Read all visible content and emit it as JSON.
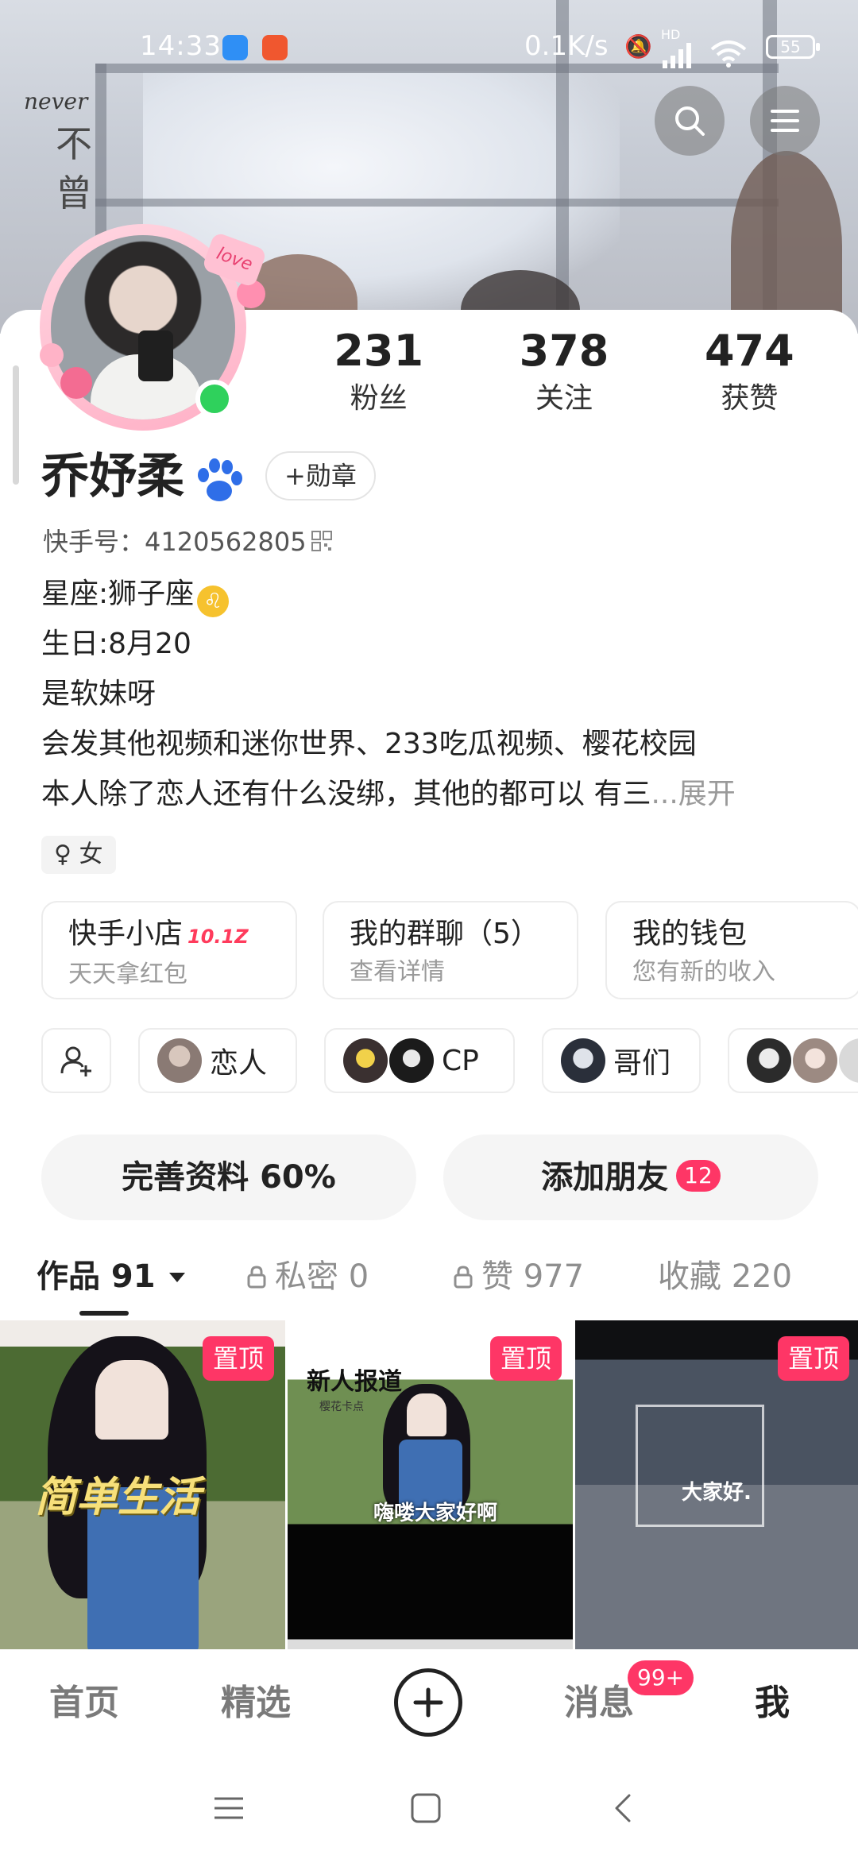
{
  "status_bar": {
    "time": "14:33",
    "net_speed": "0.1K/s",
    "network_label": "HD",
    "battery": "55"
  },
  "header": {
    "banner_vertical_text_latin": "never",
    "banner_vertical_text_cn": "不曾",
    "search_icon": "search-icon",
    "menu_icon": "menu-icon"
  },
  "profile": {
    "avatar_sticker": "love",
    "stats": [
      {
        "value": "231",
        "label": "粉丝"
      },
      {
        "value": "378",
        "label": "关注"
      },
      {
        "value": "474",
        "label": "获赞"
      }
    ],
    "name": "乔妤柔",
    "medal_button": "+勋章",
    "kwai_id": "快手号：4120562805",
    "bio": {
      "line1": "星座:狮子座",
      "leo_symbol": "♌",
      "line2": "生日:8月20",
      "line3": "是软妹呀",
      "line4": "会发其他视频和迷你世界、233吃瓜视频、樱花校园",
      "line5": "本人除了恋人还有什么没绑，其他的都可以 有三",
      "expand": "...展开"
    },
    "gender_tag": "♀ 女"
  },
  "features": [
    {
      "title": "快手小店",
      "hot": "10.1Z",
      "subtitle": "天天拿红包"
    },
    {
      "title": "我的群聊（5）",
      "subtitle": "查看详情"
    },
    {
      "title": "我的钱包",
      "subtitle": "您有新的收入"
    }
  ],
  "relations": [
    {
      "label": "恋人"
    },
    {
      "label": "CP"
    },
    {
      "label": "哥们"
    }
  ],
  "pills": {
    "complete_profile": "完善资料 60%",
    "add_friends": "添加朋友",
    "add_friends_count": "12"
  },
  "tabs": {
    "works": "作品 91",
    "private": "私密 0",
    "likes": "赞 977",
    "favorites": "收藏 220"
  },
  "videos": [
    {
      "pinned": "置顶",
      "caption": "简单生活"
    },
    {
      "pinned": "置顶",
      "title": "新人报道",
      "subtitle": "樱花卡点",
      "caption": "嗨喽大家好啊"
    },
    {
      "pinned": "置顶",
      "caption": "大家好."
    }
  ],
  "bottom_nav": {
    "home": "首页",
    "featured": "精选",
    "messages": "消息",
    "messages_badge": "99+",
    "me": "我"
  },
  "colors": {
    "accent": "#fe3666",
    "online": "#2fd15c",
    "text_primary": "#222222",
    "text_secondary": "#9a9a9a"
  }
}
